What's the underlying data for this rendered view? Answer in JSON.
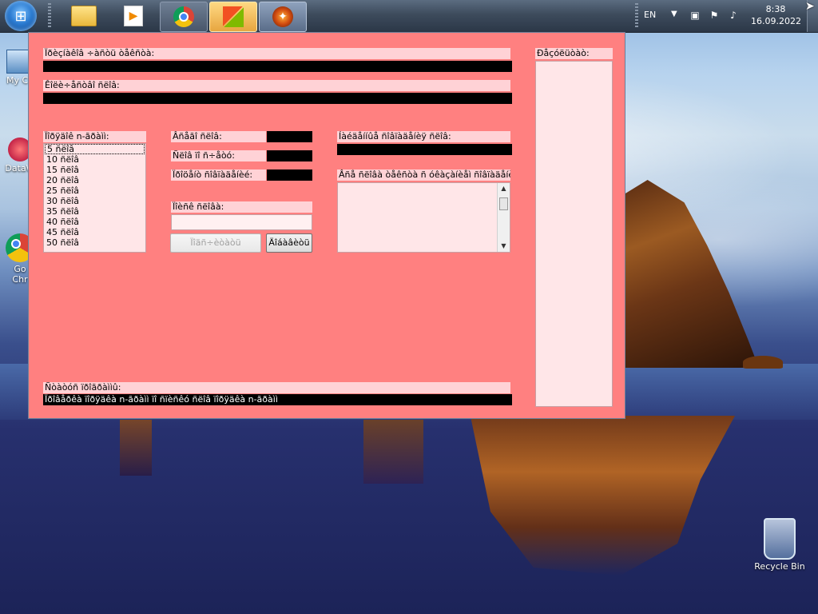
{
  "taskbar": {
    "start_icon": "windows-orb-icon",
    "apps": [
      {
        "name": "explorer-icon"
      },
      {
        "name": "media-player-icon"
      },
      {
        "name": "chrome-icon"
      },
      {
        "name": "windows-app-icon"
      },
      {
        "name": "torch-app-icon"
      }
    ],
    "language": "EN",
    "time": "8:38",
    "date": "16.09.2022"
  },
  "desktop": {
    "icons": [
      {
        "label": "My Co",
        "icon": "computer-icon"
      },
      {
        "label": "DataW",
        "icon": "dataw-icon"
      },
      {
        "label": "Go",
        "label2": "Chr",
        "icon": "chrome-icon"
      }
    ],
    "recycle_bin": "Recycle Bin"
  },
  "app": {
    "background": "#ff8080",
    "field1_label": "Ïðèçíàêîâ ÷àñòü òåêñòà:",
    "field1_value": "",
    "field2_label": "Êîëè÷åñòâî ñëîâ:",
    "field2_value": "",
    "list_label": "Ïîðÿäîê n-ãðàìì:",
    "list_items": [
      " 5 ñëîâ",
      "10 ñëîâ",
      "15 ñëîâ",
      "20 ñëîâ",
      "25 ñëîâ",
      "30 ñëîâ",
      "35 ñëîâ",
      "40 ñëîâ",
      "45 ñëîâ",
      "50 ñëîâ"
    ],
    "stat1_label": "Âñåãî ñëîâ:",
    "stat1_value": "",
    "stat2_label": "Ñëîâ ïî ñ÷åòó:",
    "stat2_value": "",
    "stat3_label": "Ïðîöåíò ñîâïàäåíèé:",
    "stat3_value": "",
    "word_input_label": "Ïîèñê ñëîâà:",
    "word_input_value": "",
    "btn_disabled_label": "Ïîäñ÷èòàòü",
    "btn_label": "Äîáàâèòü",
    "right_label1": "Íàéäåííûå ñîâïàäåíèÿ ñëîâ:",
    "right_value1": "",
    "memo_label": "Âñå ñëîâà òåêñòà ñ óêàçàíèåì ñîâïàäåíèé:",
    "status_label": "Ñòàòóñ ïðîãðàììû:",
    "status_value": "Ïðîâåðêà ïîðÿäêà n-ãðàìì ïî ñïèñêó ñëîâ ïîðÿäêà n-ãðàìì",
    "panel_label": "Ðåçóëüòàò:"
  }
}
